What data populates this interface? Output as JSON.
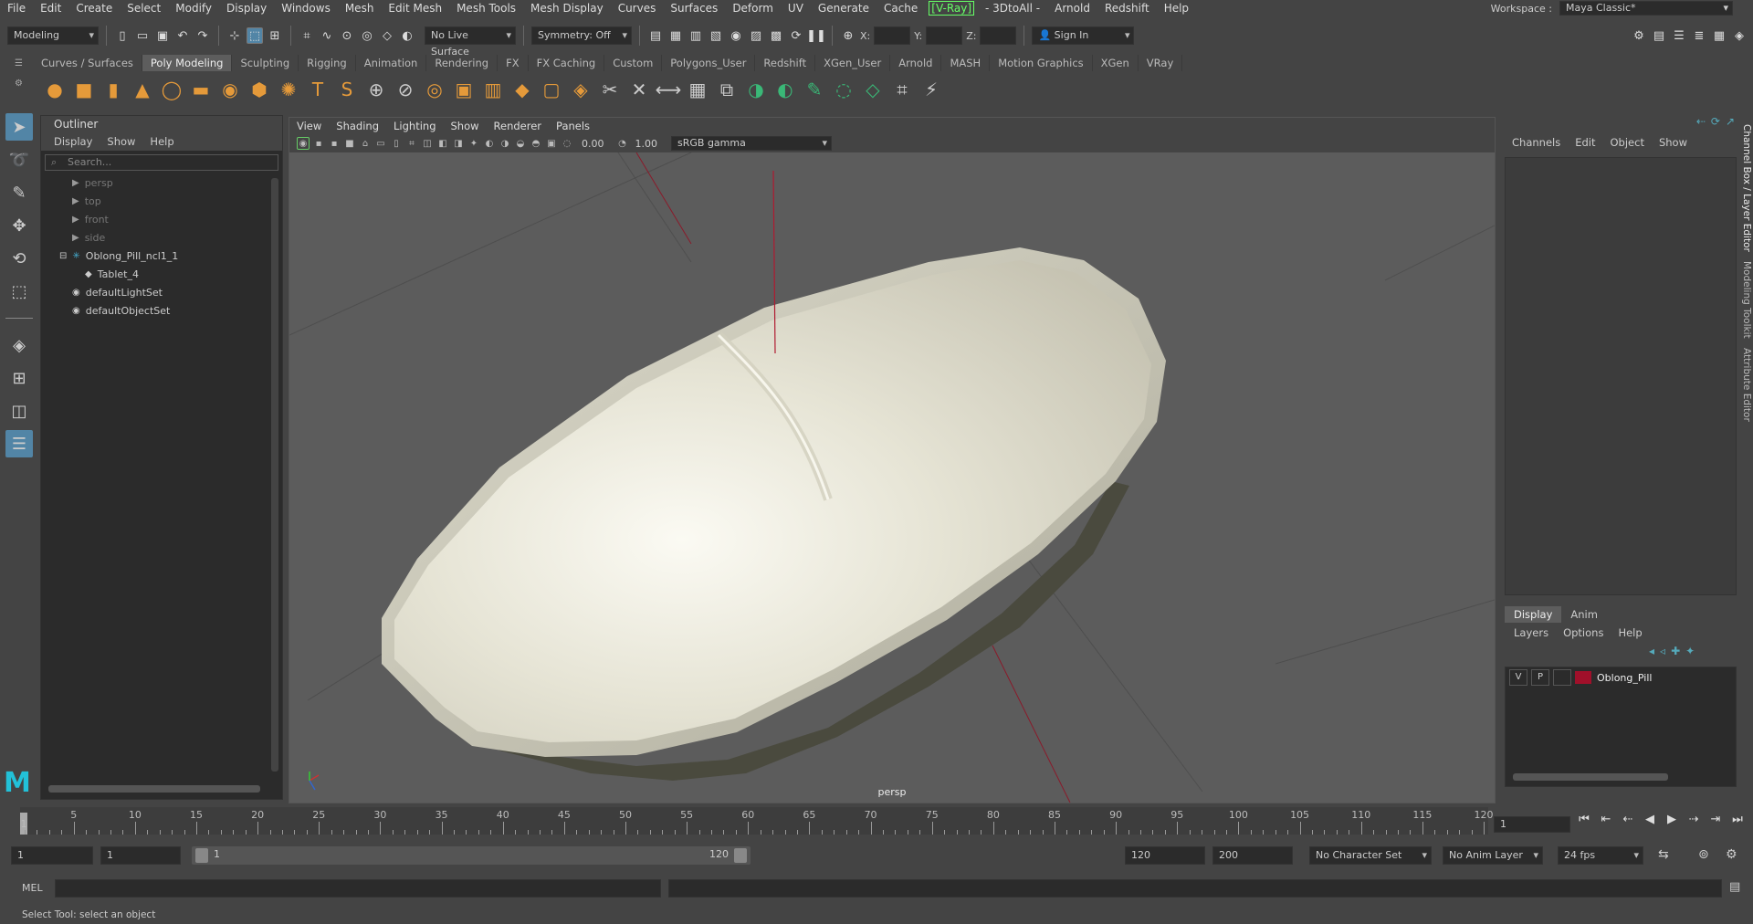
{
  "menubar": {
    "items": [
      "File",
      "Edit",
      "Create",
      "Select",
      "Modify",
      "Display",
      "Windows",
      "Mesh",
      "Edit Mesh",
      "Mesh Tools",
      "Mesh Display",
      "Curves",
      "Surfaces",
      "Deform",
      "UV",
      "Generate",
      "Cache"
    ],
    "vray": "[V-Ray]",
    "items2": [
      "- 3DtoAll -",
      "Arnold",
      "Redshift",
      "Help"
    ],
    "workspace_label": "Workspace :",
    "workspace_value": "Maya Classic*"
  },
  "statusline": {
    "mode": "Modeling",
    "live_surface": "No Live Surface",
    "symmetry": "Symmetry: Off",
    "x_label": "X:",
    "y_label": "Y:",
    "z_label": "Z:",
    "sign_in": "Sign In"
  },
  "shelf": {
    "tabs": [
      "Curves / Surfaces",
      "Poly Modeling",
      "Sculpting",
      "Rigging",
      "Animation",
      "Rendering",
      "FX",
      "FX Caching",
      "Custom",
      "Polygons_User",
      "Redshift",
      "XGen_User",
      "Arnold",
      "MASH",
      "Motion Graphics",
      "XGen",
      "VRay"
    ],
    "active_tab": "Poly Modeling",
    "icons": [
      "sphere-icon",
      "cube-icon",
      "cylinder-icon",
      "cone-icon",
      "torus-icon",
      "plane-icon",
      "disc-icon",
      "platonic-icon",
      "super-shape-icon",
      "type-icon",
      "svg-icon",
      "combine-icon",
      "separate-icon",
      "smooth-icon",
      "extrude-icon",
      "bridge-icon",
      "bevel-icon",
      "fill-hole-icon",
      "append-icon",
      "multicut-icon",
      "target-weld-icon",
      "connect-icon",
      "uv-editor-icon",
      "mirror-icon",
      "boolean-icon",
      "uv-unfold-icon",
      "sculpt-icon",
      "soft-select-icon",
      "quad-draw-icon",
      "lattice-icon",
      "retopo-icon"
    ]
  },
  "outliner": {
    "title": "Outliner",
    "menu": [
      "Display",
      "Show",
      "Help"
    ],
    "search_placeholder": "Search...",
    "items": [
      {
        "label": "persp",
        "dim": true,
        "type": "camera",
        "indent": 0
      },
      {
        "label": "top",
        "dim": true,
        "type": "camera",
        "indent": 0
      },
      {
        "label": "front",
        "dim": true,
        "type": "camera",
        "indent": 0
      },
      {
        "label": "side",
        "dim": true,
        "type": "camera",
        "indent": 0
      },
      {
        "label": "Oblong_Pill_ncl1_1",
        "dim": false,
        "type": "group",
        "indent": 0
      },
      {
        "label": "Tablet_4",
        "dim": false,
        "type": "mesh",
        "indent": 1
      },
      {
        "label": "defaultLightSet",
        "dim": false,
        "type": "set",
        "indent": 0
      },
      {
        "label": "defaultObjectSet",
        "dim": false,
        "type": "set",
        "indent": 0
      }
    ]
  },
  "viewport": {
    "menu": [
      "View",
      "Shading",
      "Lighting",
      "Show",
      "Renderer",
      "Panels"
    ],
    "exposure": "0.00",
    "gamma": "1.00",
    "colorspace": "sRGB gamma",
    "camera_label": "persp"
  },
  "channelbox": {
    "menu": [
      "Channels",
      "Edit",
      "Object",
      "Show"
    ],
    "layer_tabs": [
      "Display",
      "Anim"
    ],
    "active_layer_tab": "Display",
    "layer_menu": [
      "Layers",
      "Options",
      "Help"
    ],
    "layer": {
      "v": "V",
      "p": "P",
      "name": "Oblong_Pill",
      "color": "#a0102a"
    }
  },
  "side_tabs": [
    "Channel Box / Layer Editor",
    "Modeling Toolkit",
    "Attribute Editor"
  ],
  "timeline": {
    "labels": [
      "5",
      "10",
      "15",
      "20",
      "25",
      "30",
      "35",
      "40",
      "45",
      "50",
      "55",
      "60",
      "65",
      "70",
      "75",
      "80",
      "85",
      "90",
      "95",
      "100",
      "105",
      "110",
      "115",
      "120"
    ],
    "first_label": "1",
    "current_frame": "1"
  },
  "range": {
    "start": "1",
    "playback_start": "1",
    "slider_start": "1",
    "slider_end": "120",
    "playback_end": "120",
    "end": "200",
    "character_set": "No Character Set",
    "anim_layer": "No Anim Layer",
    "fps": "24 fps"
  },
  "mel": {
    "label": "MEL"
  },
  "status": {
    "text": "Select Tool: select an object"
  }
}
